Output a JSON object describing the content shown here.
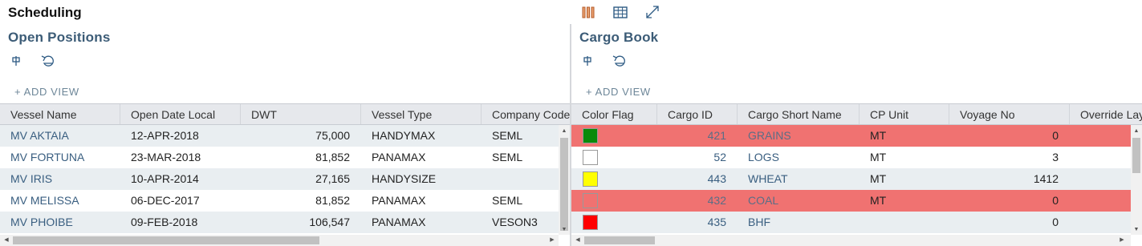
{
  "app": {
    "title": "Scheduling"
  },
  "top_icons": [
    "columns-icon",
    "table-icon",
    "expand-icon"
  ],
  "add_view_label": "+ ADD VIEW",
  "open_positions": {
    "title": "Open Positions",
    "columns": [
      "Vessel Name",
      "Open Date Local",
      "DWT",
      "Vessel Type",
      "Company Code"
    ],
    "rows": [
      [
        "MV AKTAIA",
        "12-APR-2018",
        "75,000",
        "HANDYMAX",
        "SEML"
      ],
      [
        "MV FORTUNA",
        "23-MAR-2018",
        "81,852",
        "PANAMAX",
        "SEML"
      ],
      [
        "MV IRIS",
        "10-APR-2014",
        "27,165",
        "HANDYSIZE",
        ""
      ],
      [
        "MV MELISSA",
        "06-DEC-2017",
        "81,852",
        "PANAMAX",
        "SEML"
      ],
      [
        "MV PHOIBE",
        "09-FEB-2018",
        "106,547",
        "PANAMAX",
        "VESON3"
      ]
    ]
  },
  "cargo_book": {
    "title": "Cargo Book",
    "columns": [
      "Color Flag",
      "Cargo ID",
      "Cargo Short Name",
      "CP Unit",
      "Voyage No",
      "Override Lay"
    ],
    "rows": [
      {
        "flag": "#0a8a0a",
        "cells": [
          "421",
          "GRAINS",
          "MT",
          "0",
          ""
        ],
        "highlight": true
      },
      {
        "flag": "#ffffff",
        "cells": [
          "52",
          "LOGS",
          "MT",
          "3",
          ""
        ],
        "highlight": false
      },
      {
        "flag": "#ffff00",
        "cells": [
          "443",
          "WHEAT",
          "MT",
          "1412",
          ""
        ],
        "highlight": false
      },
      {
        "flag": "#f07271",
        "cells": [
          "432",
          "COAL",
          "MT",
          "0",
          ""
        ],
        "highlight": true
      },
      {
        "flag": "#ff0000",
        "cells": [
          "435",
          "BHF",
          "",
          "0",
          ""
        ],
        "highlight": false
      }
    ]
  },
  "colors": {
    "title": "#3c5c77",
    "link": "#395e80",
    "highlight_row": "#f07271",
    "header_bg": "#e6e8ec"
  }
}
